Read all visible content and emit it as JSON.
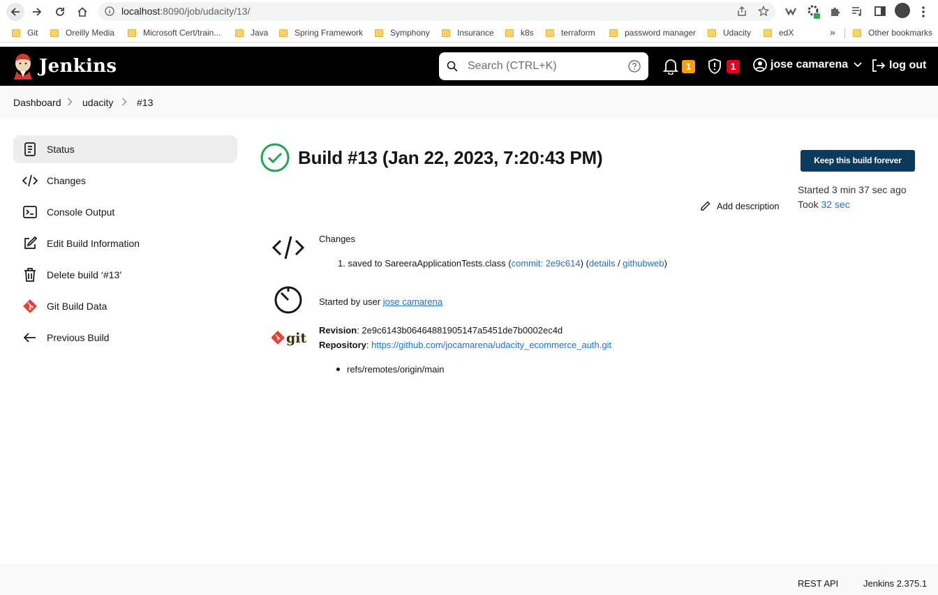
{
  "browser": {
    "url_host": "localhost",
    "url_path": ":8090/job/udacity/13/",
    "bookmarks": [
      "Git",
      "Oreilly Media",
      "Microsoft Cert/train...",
      "Java",
      "Spring Framework",
      "Symphony",
      "Insurance",
      "k8s",
      "terraform",
      "password manager",
      "Udacity",
      "edX"
    ],
    "more": "»",
    "other_bookmarks": "Other bookmarks"
  },
  "header": {
    "brand": "Jenkins",
    "search_placeholder": "Search (CTRL+K)",
    "notifications_count": "1",
    "security_count": "1",
    "user": "jose camarena",
    "logout": "log out"
  },
  "breadcrumb": [
    "Dashboard",
    "udacity",
    "#13"
  ],
  "sidebar": {
    "items": [
      {
        "label": "Status",
        "icon": "document-icon"
      },
      {
        "label": "Changes",
        "icon": "code-icon"
      },
      {
        "label": "Console Output",
        "icon": "terminal-icon"
      },
      {
        "label": "Edit Build Information",
        "icon": "edit-icon"
      },
      {
        "label": "Delete build ‘#13’",
        "icon": "trash-icon"
      },
      {
        "label": "Git Build Data",
        "icon": "git-icon"
      },
      {
        "label": "Previous Build",
        "icon": "arrow-left-icon"
      }
    ]
  },
  "build": {
    "title": "Build #13 (Jan 22, 2023, 7:20:43 PM)",
    "keep_label": "Keep this build forever",
    "started": "Started 3 min 37 sec ago",
    "took_prefix": "Took ",
    "took_value": "32 sec",
    "add_description": "Add description",
    "changes_heading": "Changes",
    "change": {
      "number": "1.",
      "text": "saved to SareeraApplicationTests.class (",
      "commit": "commit: 2e9c614",
      "mid": ") (",
      "details": "details",
      "slash": " / ",
      "githubweb": "githubweb",
      "end": ")"
    },
    "started_by_prefix": "Started by user ",
    "started_by_user": "jose camarena",
    "revision_label": "Revision",
    "revision_value": ": 2e9c6143b06464881905147a5451de7b0002ec4d",
    "repository_label": "Repository",
    "repository_sep": ": ",
    "repository_url": "https://github.com/jocamarena/udacity_ecommerce_auth.git",
    "ref": "refs/remotes/origin/main"
  },
  "footer": {
    "rest_api": "REST API",
    "version": "Jenkins 2.375.1"
  },
  "colors": {
    "success": "#1ea64b",
    "link": "#1f6fd1",
    "keep_button": "#0b3a5c",
    "badge_orange": "#fe9e00",
    "badge_red": "#e6001f"
  }
}
